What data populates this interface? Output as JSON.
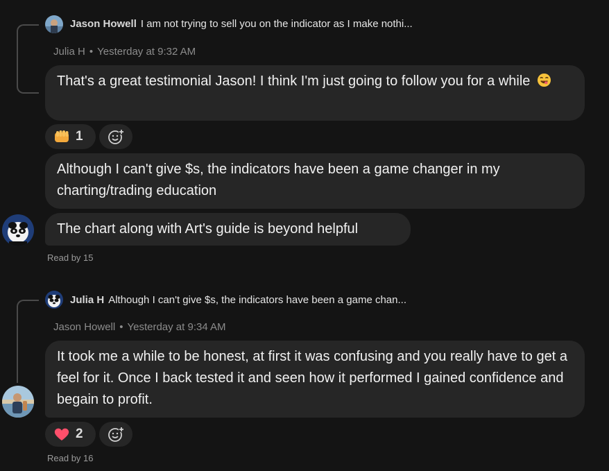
{
  "thread1": {
    "quoted_reply": {
      "author": "Jason Howell",
      "text": "I am not trying to sell you on the indicator as I make nothi..."
    },
    "meta": {
      "author": "Julia H",
      "dot": "•",
      "time": "Yesterday at 9:32 AM"
    },
    "message": "That's a great testimonial Jason! I think I'm just going to follow you for a while",
    "message_emoji": "yum-face-icon",
    "reaction": {
      "emoji": "fist-bump-icon",
      "count": "1"
    }
  },
  "standalone_messages": [
    {
      "text": "Although I can't give $s, the indicators have been a game changer in my charting/trading education"
    },
    {
      "text": "The chart along with Art's guide is beyond helpful"
    }
  ],
  "read_by_1": "Read by 15",
  "thread2": {
    "quoted_reply": {
      "author": "Julia H",
      "text": "Although I can't give $s, the indicators have been a game chan..."
    },
    "meta": {
      "author": "Jason Howell",
      "dot": "•",
      "time": "Yesterday at 9:34 AM"
    },
    "message": "It took me a while to be honest, at first it was confusing and you really have to get a feel for it. Once I back tested it and seen how it performed I gained confidence and begain to profit.",
    "reaction": {
      "emoji": "heart-icon",
      "count": "2"
    }
  },
  "read_by_2": "Read by 16",
  "colors": {
    "background": "#141414",
    "bubble": "#262626",
    "meta_text": "#8c8c8c",
    "heart": "#ff4f6b"
  }
}
